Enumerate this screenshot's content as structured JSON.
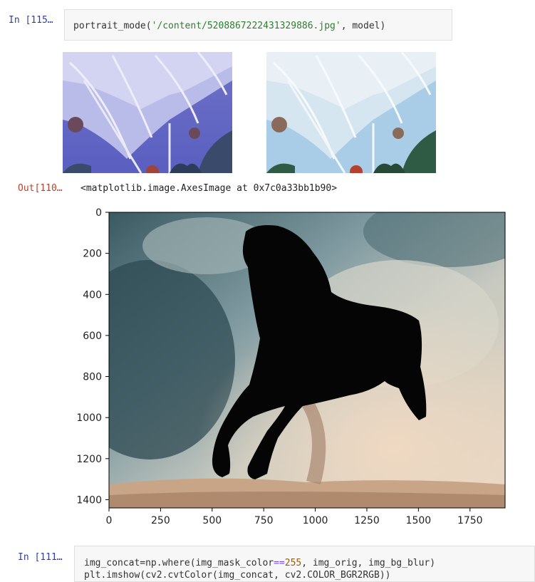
{
  "cells": {
    "in_115": {
      "prompt": "In [115…",
      "code_prefix": "portrait_mode(",
      "code_string": "'/content/5208867222431329886.jpg'",
      "code_suffix": ", model)"
    },
    "out_110": {
      "prompt": "Out[110…",
      "text": "<matplotlib.image.AxesImage at 0x7c0a33bb1b90>"
    },
    "in_111": {
      "prompt": "In [111…",
      "line1_a": "img_concat=np.where(img_mask_color",
      "line1_op": "==",
      "line1_num": "255",
      "line1_b": ", img_orig, img_bg_blur)",
      "line2": "plt.imshow(cv2.cvtColor(img_concat, cv2.COLOR_BGR2RGB))"
    }
  },
  "colors": {
    "prompt_in": "#303f9f",
    "string": "#2e7d32",
    "number": "#9c5d00"
  },
  "chart_data": {
    "type": "image",
    "x_ticks": [
      0,
      250,
      500,
      750,
      1000,
      1250,
      1500,
      1750
    ],
    "y_ticks": [
      0,
      200,
      400,
      600,
      800,
      1000,
      1200,
      1400
    ],
    "xlim": [
      0,
      1920
    ],
    "ylim": [
      1440,
      0
    ]
  }
}
